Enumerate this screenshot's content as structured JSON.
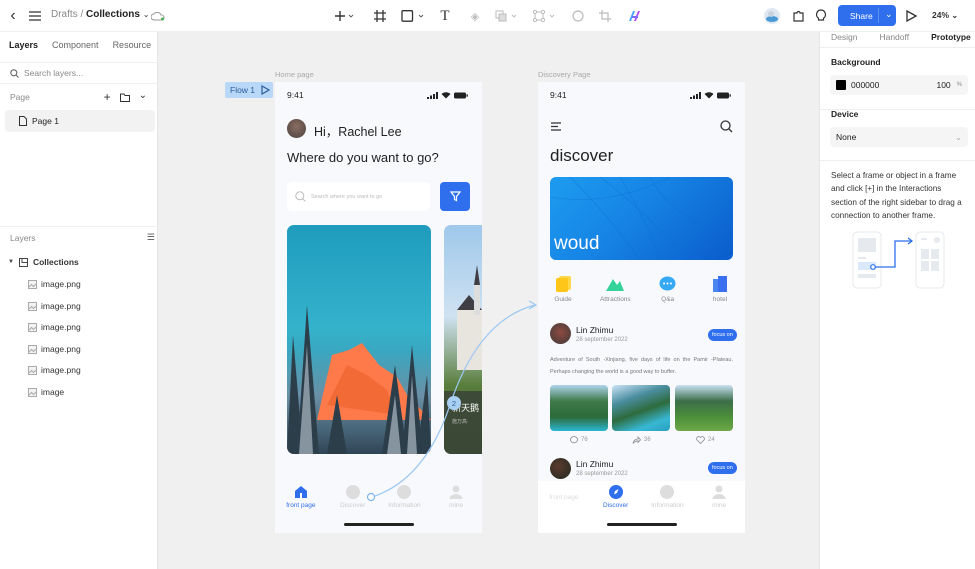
{
  "topbar": {
    "breadcrumb_parent": "Drafts",
    "breadcrumb_sep": "/",
    "breadcrumb_current": "Collections",
    "share_label": "Share",
    "zoom_level": "24%",
    "tools": [
      "plus-icon",
      "frame-icon",
      "rectangle-icon",
      "text-icon",
      "component-icon",
      "boolean-icon",
      "mask-icon",
      "circle-icon",
      "crop-icon",
      "ai-icon"
    ]
  },
  "left_panel": {
    "tabs": [
      "Layers",
      "Component",
      "Resource"
    ],
    "active_tab": "Layers",
    "search_placeholder": "Search layers...",
    "page_header": "Page",
    "pages": [
      "Page 1"
    ],
    "layers_header": "Layers",
    "layers": [
      {
        "name": "Collections",
        "type": "frame",
        "level": 0
      },
      {
        "name": "image.png",
        "type": "image",
        "level": 1
      },
      {
        "name": "image.png",
        "type": "image",
        "level": 1
      },
      {
        "name": "image.png",
        "type": "image",
        "level": 1
      },
      {
        "name": "image.png",
        "type": "image",
        "level": 1
      },
      {
        "name": "image.png",
        "type": "image",
        "level": 1
      },
      {
        "name": "image",
        "type": "image",
        "level": 1
      }
    ]
  },
  "right_panel": {
    "tabs": [
      "Design",
      "Handoff",
      "Prototype"
    ],
    "active_tab": "Prototype",
    "background_label": "Background",
    "background_hex": "000000",
    "background_opacity": "100",
    "opacity_unit": "%",
    "device_label": "Device",
    "device_value": "None",
    "help_text": "Select a frame or object in a frame and click [+] in the Interactions section of the right sidebar to drag a connection to another frame."
  },
  "canvas": {
    "flow_label": "Flow 1",
    "connection_badge": "2",
    "home_frame": {
      "label": "Home page",
      "time": "9:41",
      "greeting": "Hi，Rachel Lee",
      "question": "Where do you want to go?",
      "search_placeholder": "Search where you want to go",
      "card2_title": "新天鹅",
      "card2_sub": "施万高·",
      "nav": [
        {
          "label": "front page",
          "active": true
        },
        {
          "label": "Discover",
          "active": false
        },
        {
          "label": "Information",
          "active": false
        },
        {
          "label": "mine",
          "active": false
        }
      ]
    },
    "discover_frame": {
      "label": "Discovery Page",
      "time": "9:41",
      "title": "discover",
      "banner_text": "woud",
      "categories": [
        "Guide",
        "Attractions",
        "Q&a",
        "hotel"
      ],
      "posts": [
        {
          "author": "Lin Zhimu",
          "date": "28 september 2022",
          "follow": "focus on",
          "text": "Adventure of South -Xinjiang, five days of life on the Pamir -Plateau. Perhaps changing the world is a good way to buffer.",
          "comments": "76",
          "shares": "36",
          "likes": "24"
        },
        {
          "author": "Lin Zhimu",
          "date": "28 september 2022",
          "follow": "focus on"
        }
      ],
      "nav": [
        {
          "label": "front page",
          "active": false
        },
        {
          "label": "Discover",
          "active": true
        },
        {
          "label": "Information",
          "active": false
        },
        {
          "label": "mine",
          "active": false
        }
      ]
    }
  },
  "colors": {
    "accent": "#2f6fee",
    "flow_bg": "#b9d7f6"
  }
}
